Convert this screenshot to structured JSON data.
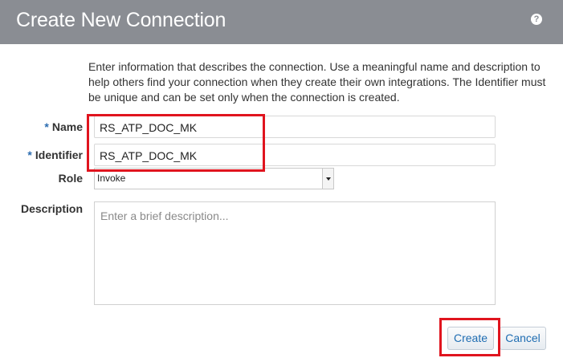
{
  "dialog": {
    "title": "Create New Connection",
    "help_icon": "help-icon",
    "help_glyph": "?",
    "intro": "Enter information that describes the connection. Use a meaningful name and description to help others find your connection when they create their own integrations. The Identifier must be unique and can be set only when the connection is created."
  },
  "form": {
    "required_mark": "*",
    "name": {
      "label": "Name",
      "value": "RS_ATP_DOC_MK"
    },
    "identifier": {
      "label": "Identifier",
      "value": "RS_ATP_DOC_MK"
    },
    "role": {
      "label": "Role",
      "value": "Invoke"
    },
    "description": {
      "label": "Description",
      "placeholder": "Enter a brief description..."
    }
  },
  "buttons": {
    "create": "Create",
    "cancel": "Cancel"
  },
  "colors": {
    "titlebar": "#8a8d93",
    "highlight": "#e0141e",
    "link": "#1f6db2",
    "required": "#2b6cb0"
  }
}
